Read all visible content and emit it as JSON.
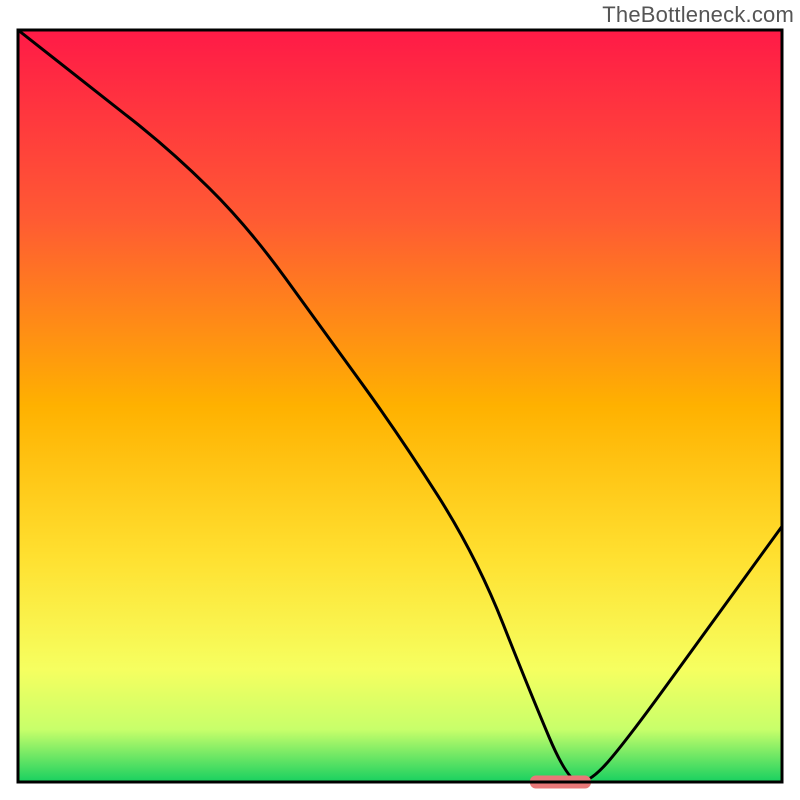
{
  "watermark": "TheBottleneck.com",
  "chart_data": {
    "type": "line",
    "title": "",
    "xlabel": "",
    "ylabel": "",
    "xlim": [
      0,
      100
    ],
    "ylim": [
      0,
      100
    ],
    "x": [
      0,
      10,
      20,
      30,
      40,
      50,
      60,
      67,
      72,
      75,
      80,
      90,
      100
    ],
    "values": [
      100,
      92,
      84,
      74,
      60,
      46,
      30,
      12,
      0,
      0,
      6,
      20,
      34
    ],
    "marker": {
      "x_range": [
        67,
        75
      ],
      "y": 0
    },
    "gradient_stops": [
      {
        "offset": 0.0,
        "color": "#ff1a47"
      },
      {
        "offset": 0.25,
        "color": "#ff5a33"
      },
      {
        "offset": 0.5,
        "color": "#ffb100"
      },
      {
        "offset": 0.7,
        "color": "#ffe030"
      },
      {
        "offset": 0.85,
        "color": "#f6ff60"
      },
      {
        "offset": 0.93,
        "color": "#c8ff6a"
      },
      {
        "offset": 1.0,
        "color": "#18d060"
      }
    ],
    "marker_color": "#e97878",
    "line_color": "#000000",
    "frame_color": "#000000"
  }
}
